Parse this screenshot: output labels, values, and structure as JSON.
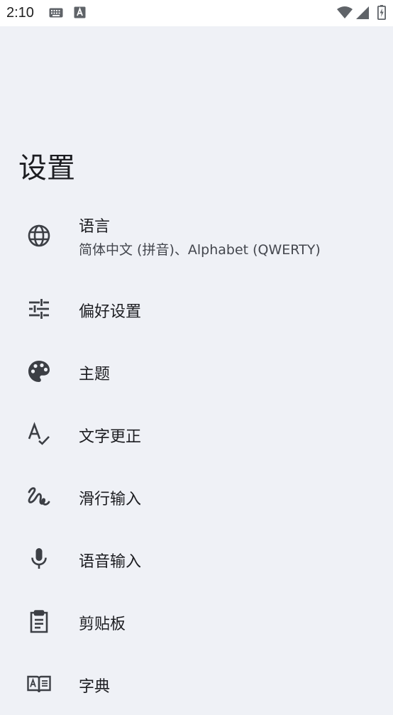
{
  "status_bar": {
    "time": "2:10"
  },
  "page": {
    "title": "设置"
  },
  "menu": {
    "items": [
      {
        "label": "语言",
        "subtitle": "简体中文 (拼音)、Alphabet (QWERTY)",
        "icon": "globe-icon"
      },
      {
        "label": "偏好设置",
        "icon": "tune-sliders-icon"
      },
      {
        "label": "主题",
        "icon": "palette-icon"
      },
      {
        "label": "文字更正",
        "icon": "spellcheck-icon"
      },
      {
        "label": "滑行输入",
        "icon": "gesture-icon"
      },
      {
        "label": "语音输入",
        "icon": "microphone-icon"
      },
      {
        "label": "剪贴板",
        "icon": "clipboard-icon"
      },
      {
        "label": "字典",
        "icon": "dictionary-icon"
      }
    ]
  }
}
